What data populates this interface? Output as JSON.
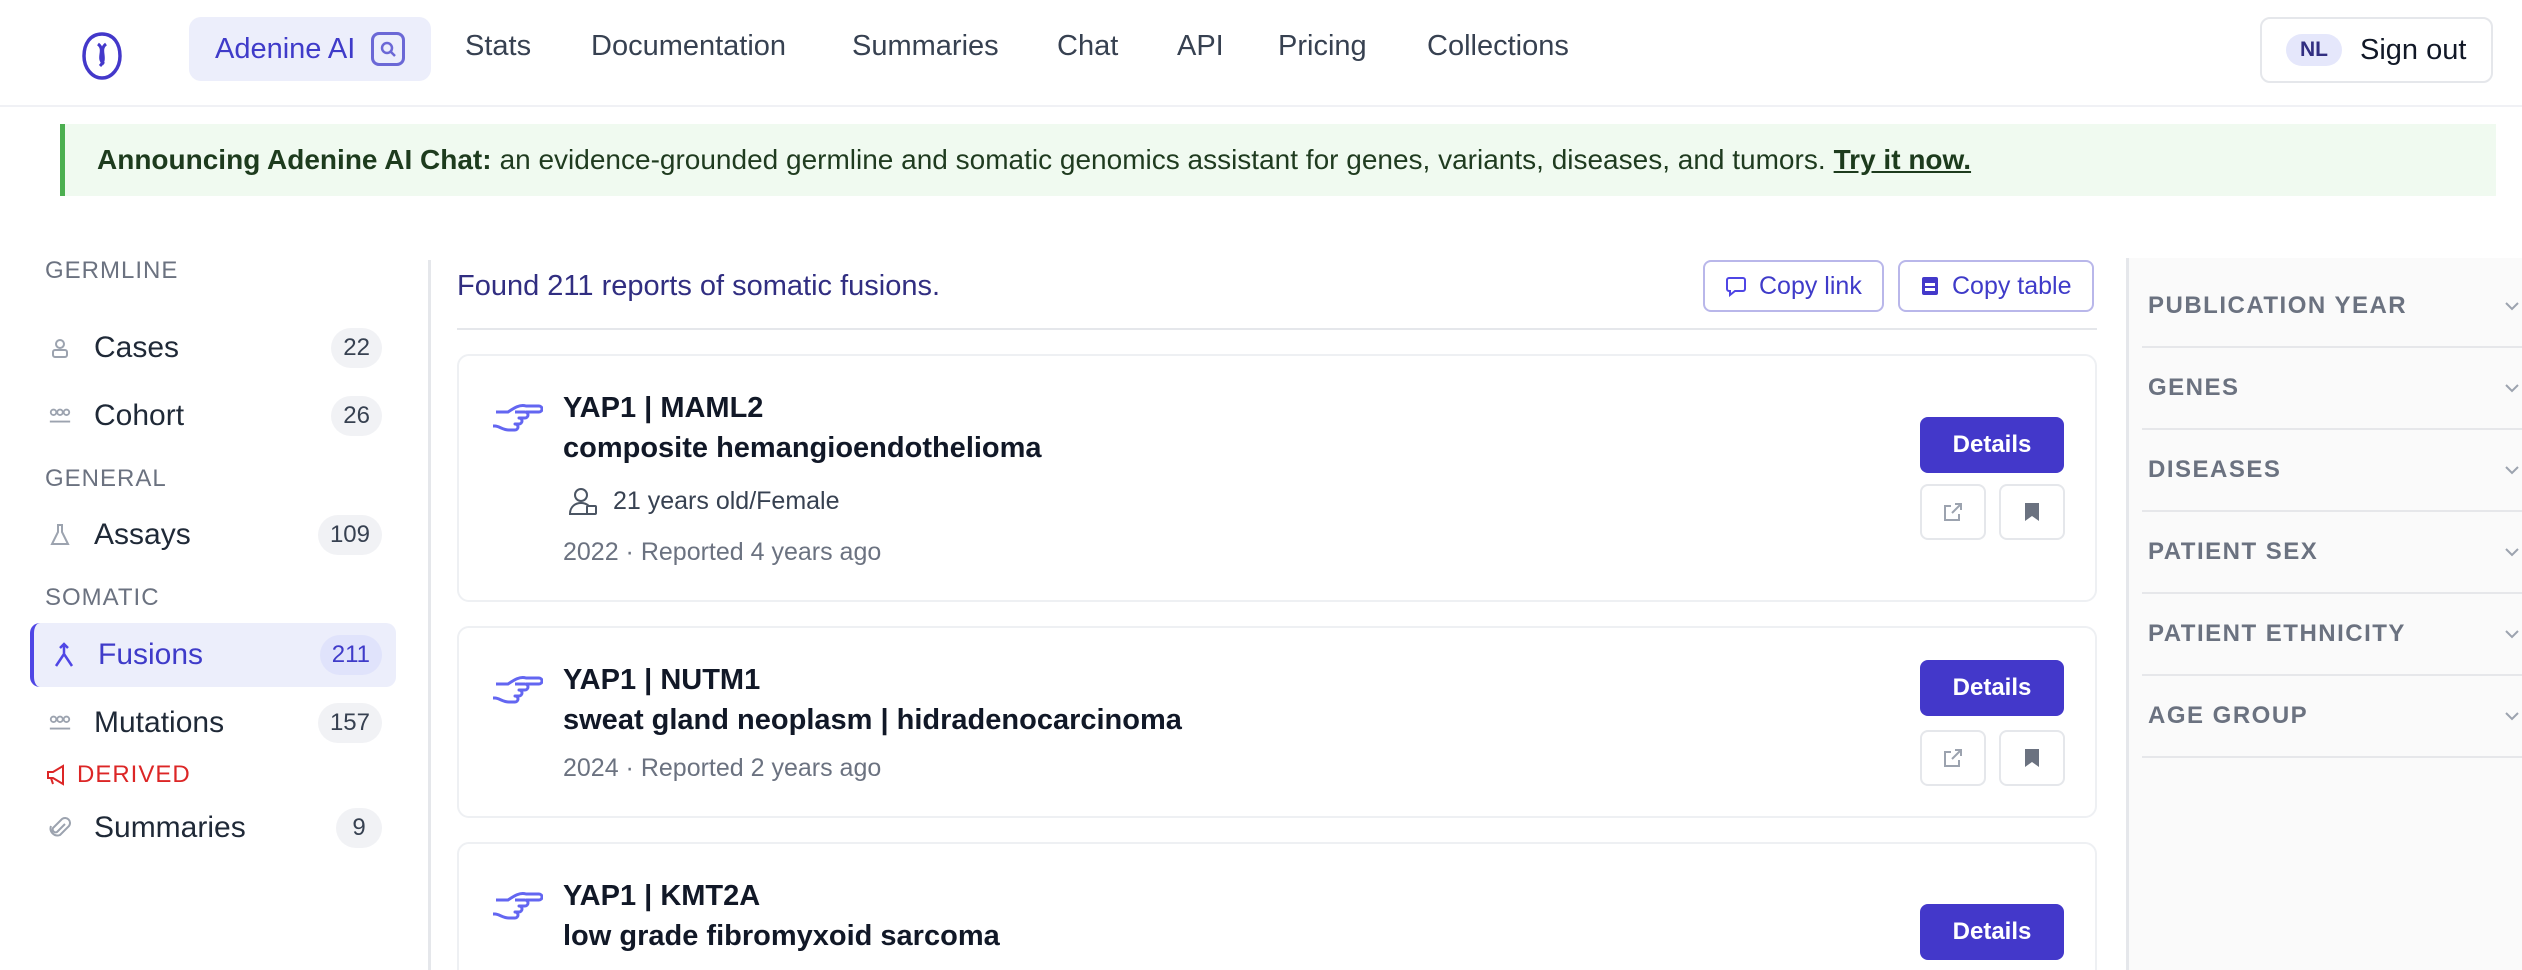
{
  "nav": {
    "brand": "Adenine AI",
    "items": [
      "Stats",
      "Documentation",
      "Summaries",
      "Chat",
      "API",
      "Pricing",
      "Collections"
    ],
    "avatar_initials": "NL",
    "signout": "Sign out",
    "accent_color": "#4338ca"
  },
  "announcement": {
    "bold": "Announcing Adenine AI Chat:",
    "text": "an evidence-grounded germline and somatic genomics assistant for genes, variants, diseases, and tumors.",
    "link": "Try it now."
  },
  "sidebar": {
    "germline_heading": "GERMLINE",
    "general_heading": "GENERAL",
    "somatic_heading": "SOMATIC",
    "derived_heading": "DERIVED",
    "items": [
      {
        "label": "Cases",
        "count": "22",
        "icon": "user-lock-icon"
      },
      {
        "label": "Cohort",
        "count": "26",
        "icon": "users-icon"
      },
      {
        "label": "Assays",
        "count": "109",
        "icon": "flask-icon"
      },
      {
        "label": "Fusions",
        "count": "211",
        "icon": "merge-icon",
        "active": true
      },
      {
        "label": "Mutations",
        "count": "157",
        "icon": "users-icon"
      },
      {
        "label": "Summaries",
        "count": "9",
        "icon": "paperclip-icon"
      }
    ]
  },
  "results": {
    "found_text": "Found 211 reports of somatic fusions.",
    "copy_link": "Copy link",
    "copy_table": "Copy table",
    "details_label": "Details",
    "cards": [
      {
        "title": "YAP1 | MAML2",
        "subtitle": "composite hemangioendothelioma",
        "patient": "21 years old/Female",
        "meta": "2022 · Reported 4 years ago"
      },
      {
        "title": "YAP1 | NUTM1",
        "subtitle": "sweat gland neoplasm | hidradenocarcinoma",
        "meta": "2024 · Reported 2 years ago"
      },
      {
        "title": "YAP1 | KMT2A",
        "subtitle": "low grade fibromyxoid sarcoma"
      }
    ]
  },
  "filters": [
    "PUBLICATION YEAR",
    "GENES",
    "DISEASES",
    "PATIENT SEX",
    "PATIENT ETHNICITY",
    "AGE GROUP"
  ]
}
